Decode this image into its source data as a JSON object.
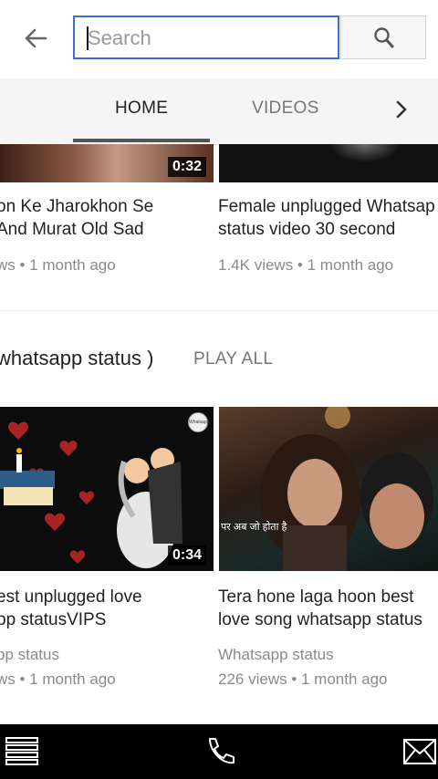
{
  "search": {
    "placeholder": "Search",
    "value": ""
  },
  "tabs": [
    {
      "label": "HOME"
    },
    {
      "label": "VIDEOS"
    }
  ],
  "videos_top": [
    {
      "duration": "0:32",
      "title_line1": "on Ke Jharokhon Se",
      "title_line2": "And Murat Old Sad",
      "meta": "ws • 1 month ago"
    },
    {
      "title_line1": "Female unplugged Whatsap",
      "title_line2": "status video 30 second",
      "meta": "1.4K views • 1 month ago"
    }
  ],
  "section": {
    "title": "whatsapp status )",
    "play_all": "PLAY ALL"
  },
  "videos_bottom": [
    {
      "duration": "0:34",
      "title_line1": "est unplugged love",
      "title_line2": "pp statusVIPS",
      "channel": "pp status",
      "meta": "ws • 1 month ago",
      "icon_text": "Whatsapp"
    },
    {
      "overlay_text": "पर अब जो होता है",
      "title_line1": "Tera hone laga hoon best",
      "title_line2": "love song whatsapp status",
      "channel": "Whatsapp status",
      "meta": "226 views • 1 month ago"
    }
  ],
  "icons": {
    "back": "arrow-left-icon",
    "search": "magnifier-icon",
    "next": "chevron-right-icon",
    "menu": "menu-icon",
    "phone": "phone-icon",
    "mail": "mail-icon"
  }
}
